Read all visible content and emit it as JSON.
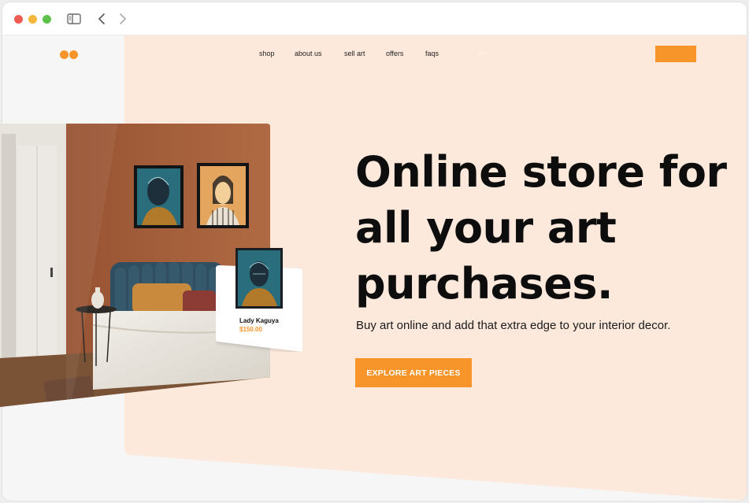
{
  "browser": {
    "controls": [
      "close",
      "minimize",
      "maximize"
    ],
    "icons": [
      "sidebar-icon",
      "back-arrow-icon",
      "forward-arrow-icon"
    ]
  },
  "site": {
    "logo_icon": "two-orange-dots-logo",
    "nav": {
      "shop": "shop",
      "about": "about us",
      "sell": "sell art",
      "offers": "offers",
      "faqs": "faqs",
      "faint": "user"
    }
  },
  "product_card": {
    "title": "Lady Kaguya",
    "price": "$150.00"
  },
  "hero": {
    "headline_line1": "Online store for",
    "headline_line2": "all your art",
    "headline_line3": "purchases.",
    "subheadline": "Buy art online and add that extra edge to your interior decor.",
    "cta_label": "EXPLORE ART PIECES"
  },
  "colors": {
    "accent": "#f7952a",
    "hero_background": "#fde9dc",
    "page_background": "#f6f6f6",
    "text": "#0d0d0d",
    "wall": "#a9613c"
  }
}
